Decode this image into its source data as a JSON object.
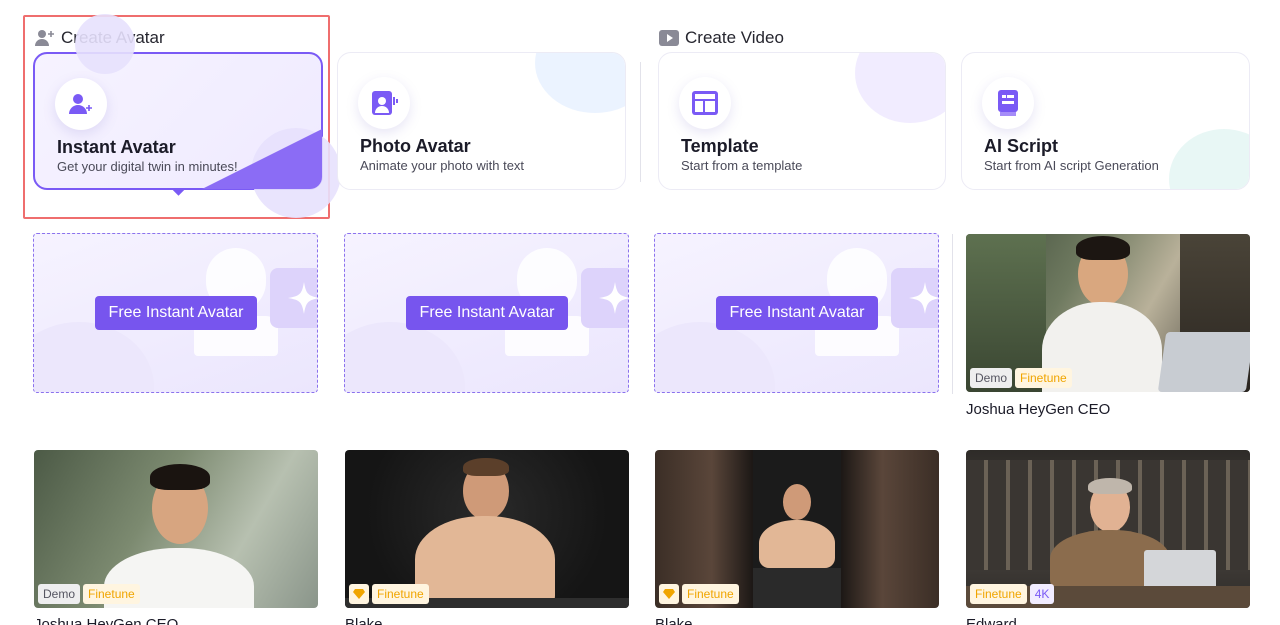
{
  "create_avatar": {
    "title": "Create Avatar",
    "cards": [
      {
        "title": "Instant Avatar",
        "subtitle": "Get your digital twin in minutes!",
        "icon": "user-plus-icon"
      },
      {
        "title": "Photo Avatar",
        "subtitle": "Animate your photo with text",
        "icon": "photo-avatar-icon"
      }
    ]
  },
  "create_video": {
    "title": "Create Video",
    "cards": [
      {
        "title": "Template",
        "subtitle": "Start from a template",
        "icon": "template-icon"
      },
      {
        "title": "AI Script",
        "subtitle": "Start from AI script Generation",
        "icon": "script-icon"
      }
    ]
  },
  "placeholders": [
    {
      "button_label": "Free Instant Avatar"
    },
    {
      "button_label": "Free Instant Avatar"
    },
    {
      "button_label": "Free Instant Avatar"
    }
  ],
  "avatars": [
    {
      "name": "Joshua HeyGen CEO",
      "badges": [
        "Demo",
        "Finetune"
      ]
    },
    {
      "name": "Joshua HeyGen CEO",
      "badges": [
        "Demo",
        "Finetune"
      ]
    },
    {
      "name": "Blake",
      "badges": [
        "Finetune"
      ],
      "gem_badge": true
    },
    {
      "name": "Blake",
      "badges": [
        "Finetune"
      ],
      "gem_badge": true
    },
    {
      "name": "Edward",
      "badges": [
        "Finetune",
        "4K"
      ]
    }
  ],
  "colors": {
    "accent": "#7755ee",
    "highlight_border": "#ef6e6e",
    "finetune": "#f0a500"
  }
}
